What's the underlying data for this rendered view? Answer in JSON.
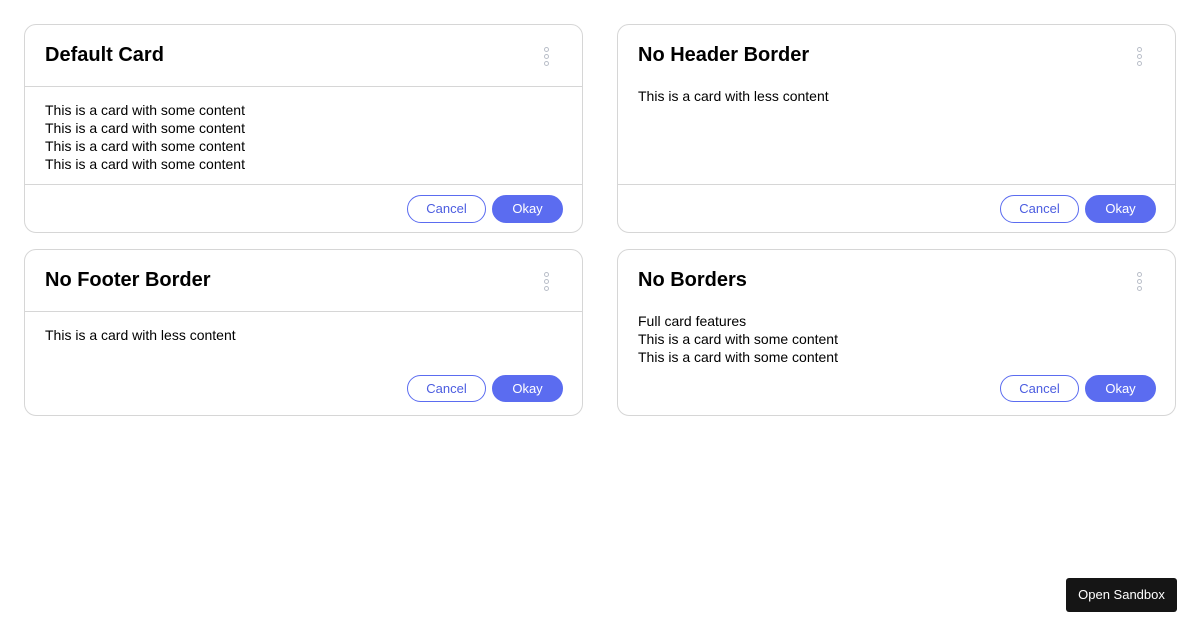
{
  "cards": [
    {
      "title": "Default Card",
      "lines": [
        "This is a card with some content",
        "This is a card with some content",
        "This is a card with some content",
        "This is a card with some content"
      ],
      "cancel_label": "Cancel",
      "okay_label": "Okay"
    },
    {
      "title": "No Header Border",
      "lines": [
        "This is a card with less content"
      ],
      "cancel_label": "Cancel",
      "okay_label": "Okay"
    },
    {
      "title": "No Footer Border",
      "lines": [
        "This is a card with less content"
      ],
      "cancel_label": "Cancel",
      "okay_label": "Okay"
    },
    {
      "title": "No Borders",
      "lines": [
        "Full card features",
        "This is a card with some content",
        "This is a card with some content"
      ],
      "cancel_label": "Cancel",
      "okay_label": "Okay"
    }
  ],
  "sandbox_button_label": "Open Sandbox",
  "colors": {
    "accent": "#5b6cf0",
    "border": "#d6d6d6",
    "sandbox_bg": "#151515"
  }
}
